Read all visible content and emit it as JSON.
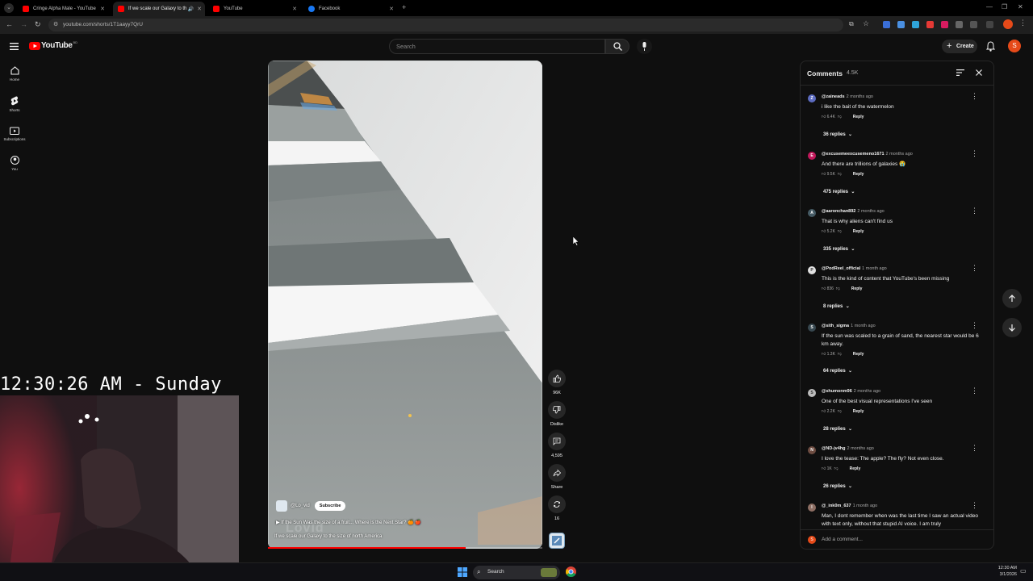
{
  "browser": {
    "tabs": [
      {
        "title": "Cringe Alpha Male - YouTube",
        "color": "#ff0000"
      },
      {
        "title": "If we scale our Galaxy to th",
        "color": "#ff0000"
      },
      {
        "title": "YouTube",
        "color": "#ff0000"
      },
      {
        "title": "Facebook",
        "color": "#1877f2"
      }
    ],
    "url": "youtube.com/shorts/1T1aayy7QrU"
  },
  "header": {
    "logo": "YouTube",
    "country_badge": "BD",
    "search_placeholder": "Search",
    "create_label": "Create",
    "avatar_letter": "S"
  },
  "sidebar": {
    "items": [
      {
        "label": "Home"
      },
      {
        "label": "Shorts"
      },
      {
        "label": "Subscriptions"
      },
      {
        "label": "You"
      }
    ]
  },
  "video": {
    "channel": "@Lo_vid",
    "subscribe_label": "Subscribe",
    "playlist_text": "If the Sun Was the size of a fruit... Where is the Next Star? 🍊 🍎",
    "title": "If we scale our Galaxy to the size of north America",
    "watermark": "Lovid",
    "progress": 0.72
  },
  "actions": {
    "likes": "96K",
    "dislike_label": "Dislike",
    "comments": "4,595",
    "share_label": "Share",
    "remix": "16"
  },
  "overlay": {
    "clock": "12:30:26 AM - Sunday"
  },
  "comments_panel": {
    "title": "Comments",
    "count": "4.5K",
    "add_placeholder": "Add a comment...",
    "reply_label": "Reply",
    "items": [
      {
        "initial": "Z",
        "avatar_color": "#5c6bc0",
        "author": "@zaineads",
        "time": "2 months ago",
        "text": "i like the bait of the watermelon",
        "likes": "6.4K",
        "replies": "36 replies"
      },
      {
        "initial": "E",
        "avatar_color": "#c2185b",
        "author": "@excusemeexcusemeno1671",
        "time": "2 months ago",
        "text": "And there are trillions of galaxies 😭",
        "likes": "9.5K",
        "replies": "475 replies"
      },
      {
        "initial": "A",
        "avatar_color": "#455a64",
        "author": "@aaronchan892",
        "time": "2 months ago",
        "text": "That is why aliens can't find us",
        "likes": "5.2K",
        "replies": "335 replies"
      },
      {
        "initial": "P",
        "avatar_color": "#e0e0e0",
        "author": "@PodReel_official",
        "time": "1 month ago",
        "text": "This is the kind of content that YouTube's been missing",
        "likes": "836",
        "replies": "8 replies"
      },
      {
        "initial": "S",
        "avatar_color": "#37474f",
        "author": "@sith_sigma",
        "time": "1 month ago",
        "text": "If the sun was scaled to a grain of sand, the nearest star would be 6 km away.",
        "likes": "1.3K",
        "replies": "64 replies"
      },
      {
        "initial": "S",
        "avatar_color": "#bdbdbd",
        "author": "@shumonm96",
        "time": "2 months ago",
        "text": "One of the best visual representations I've seen",
        "likes": "2.2K",
        "replies": "28 replies"
      },
      {
        "initial": "N",
        "avatar_color": "#6d4c41",
        "author": "@ND-jv4hg",
        "time": "2 months ago",
        "text": "I love the tease: The apple? The fly? Not even close.",
        "likes": "1K",
        "replies": "26 replies"
      },
      {
        "initial": "I",
        "avatar_color": "#8d6e63",
        "author": "@_ink0m_637",
        "time": "1 month ago",
        "text": "Man, I dont remember when was the last time I saw an actual video with text only, without that stupid AI voice. I am truly",
        "likes": "",
        "replies": ""
      }
    ]
  },
  "taskbar": {
    "search_label": "Search",
    "time": "12:30 AM",
    "date": "3/1/2026"
  }
}
